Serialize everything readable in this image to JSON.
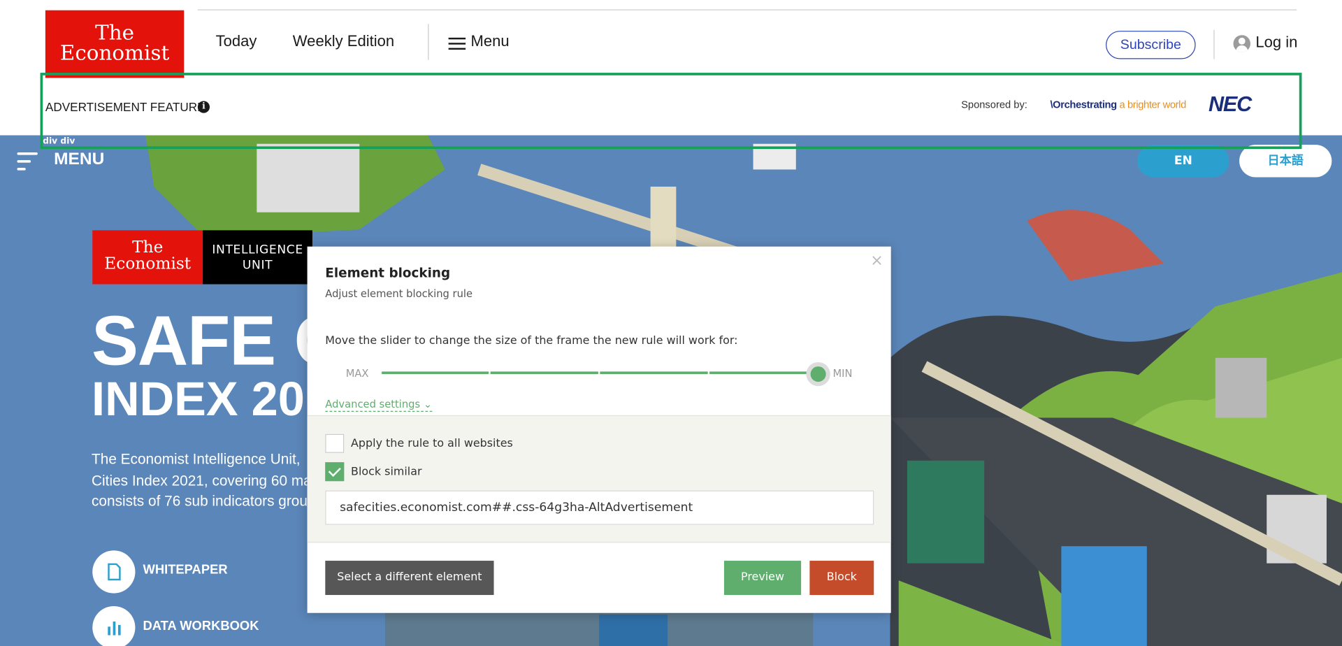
{
  "header": {
    "logo_line1": "The",
    "logo_line2": "Economist",
    "nav_today": "Today",
    "nav_weekly": "Weekly Edition",
    "nav_menu": "Menu",
    "subscribe": "Subscribe",
    "login": "Log in"
  },
  "ad_bar": {
    "label": "ADVERTISEMENT FEATURE",
    "info": "i",
    "sponsored_by": "Sponsored by:",
    "sponsor_tagline_prefix": "\\Orchestrating",
    "sponsor_tagline_suffix": " a brighter world",
    "sponsor_logo": "NEC",
    "highlight_tag": "div div"
  },
  "hero": {
    "menu_label": "MENU",
    "lang_en": "EN",
    "lang_jp": "日本語",
    "eiu_line1": "The",
    "eiu_line2": "Economist",
    "eiu_unit_line1": "INTELLIGENCE",
    "eiu_unit_line2": "UNIT",
    "title_line1": "SAFE C",
    "title_line2": "INDEX 20",
    "desc_line1": "The Economist Intelligence Unit,",
    "desc_line2": "Cities Index 2021, covering 60 ma",
    "desc_line3": "consists of 76 sub indicators grou",
    "link_whitepaper": "WHITEPAPER",
    "link_workbook": "DATA WORKBOOK"
  },
  "modal": {
    "title": "Element blocking",
    "subtitle": "Adjust element blocking rule",
    "instruction": "Move the slider to change the size of the frame the new rule will work for:",
    "slider_max": "MAX",
    "slider_min": "MIN",
    "slider_value": 1.0,
    "advanced": "Advanced settings",
    "apply_all_label": "Apply the rule to all websites",
    "apply_all_checked": false,
    "block_similar_label": "Block similar",
    "block_similar_checked": true,
    "rule_value": "safecities.economist.com##.css-64g3ha-AltAdvertisement",
    "btn_select_different": "Select a different element",
    "btn_preview": "Preview",
    "btn_block": "Block",
    "close": "×"
  },
  "colors": {
    "economist_red": "#e3120b",
    "highlight_green": "#17a05a",
    "accent_green": "#5fae6e",
    "block_red": "#c44c2a",
    "subscribe_blue": "#2e45b8",
    "lang_blue": "#2ba0cf"
  }
}
